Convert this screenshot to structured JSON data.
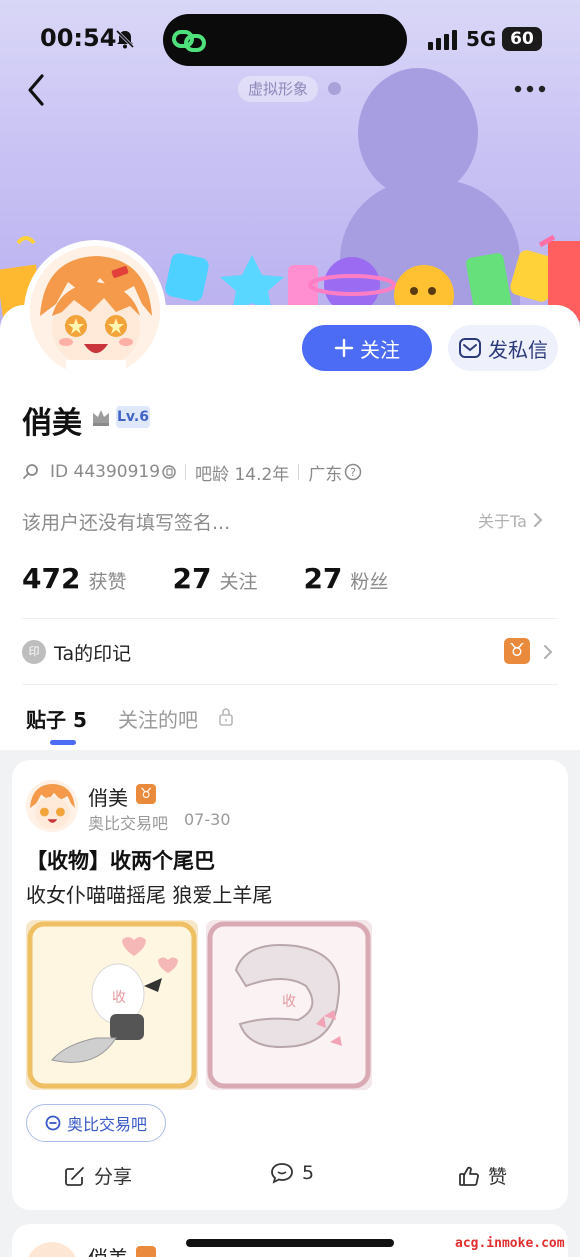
{
  "status_bar": {
    "time": "00:54",
    "network": "5G",
    "battery": "60"
  },
  "header": {
    "avatar_tag": "虚拟形象"
  },
  "profile": {
    "name": "俏美",
    "level": "Lv.6",
    "id_text": "ID 44390919",
    "bar_age": "吧龄 14.2年",
    "location": "广东",
    "signature": "该用户还没有填写签名...",
    "about_link": "关于Ta",
    "follow_label": "关注",
    "message_label": "发私信"
  },
  "stats": [
    {
      "value": "472",
      "label": "获赞"
    },
    {
      "value": "27",
      "label": "关注"
    },
    {
      "value": "27",
      "label": "粉丝"
    }
  ],
  "seal": {
    "icon_text": "印",
    "title": "Ta的印记",
    "zodiac": "♉"
  },
  "tabs": {
    "posts": "贴子 5",
    "followed_bars": "关注的吧"
  },
  "post": {
    "author": "俏美",
    "zodiac": "♉",
    "forum": "奥比交易吧",
    "date": "07-30",
    "title": "【收物】收两个尾巴",
    "body": "收女仆喵喵摇尾 狼爱上羊尾",
    "image_label": "收",
    "forum_pill": "奥比交易吧",
    "share_label": "分享",
    "comment_count": "5",
    "like_label": "赞"
  },
  "post2": {
    "author": "俏美"
  },
  "watermark": "acg.inmoke.com",
  "colors": {
    "accent": "#4c6cf5",
    "banner": "#c9c3f4",
    "zodiac": "#e98a3c"
  }
}
